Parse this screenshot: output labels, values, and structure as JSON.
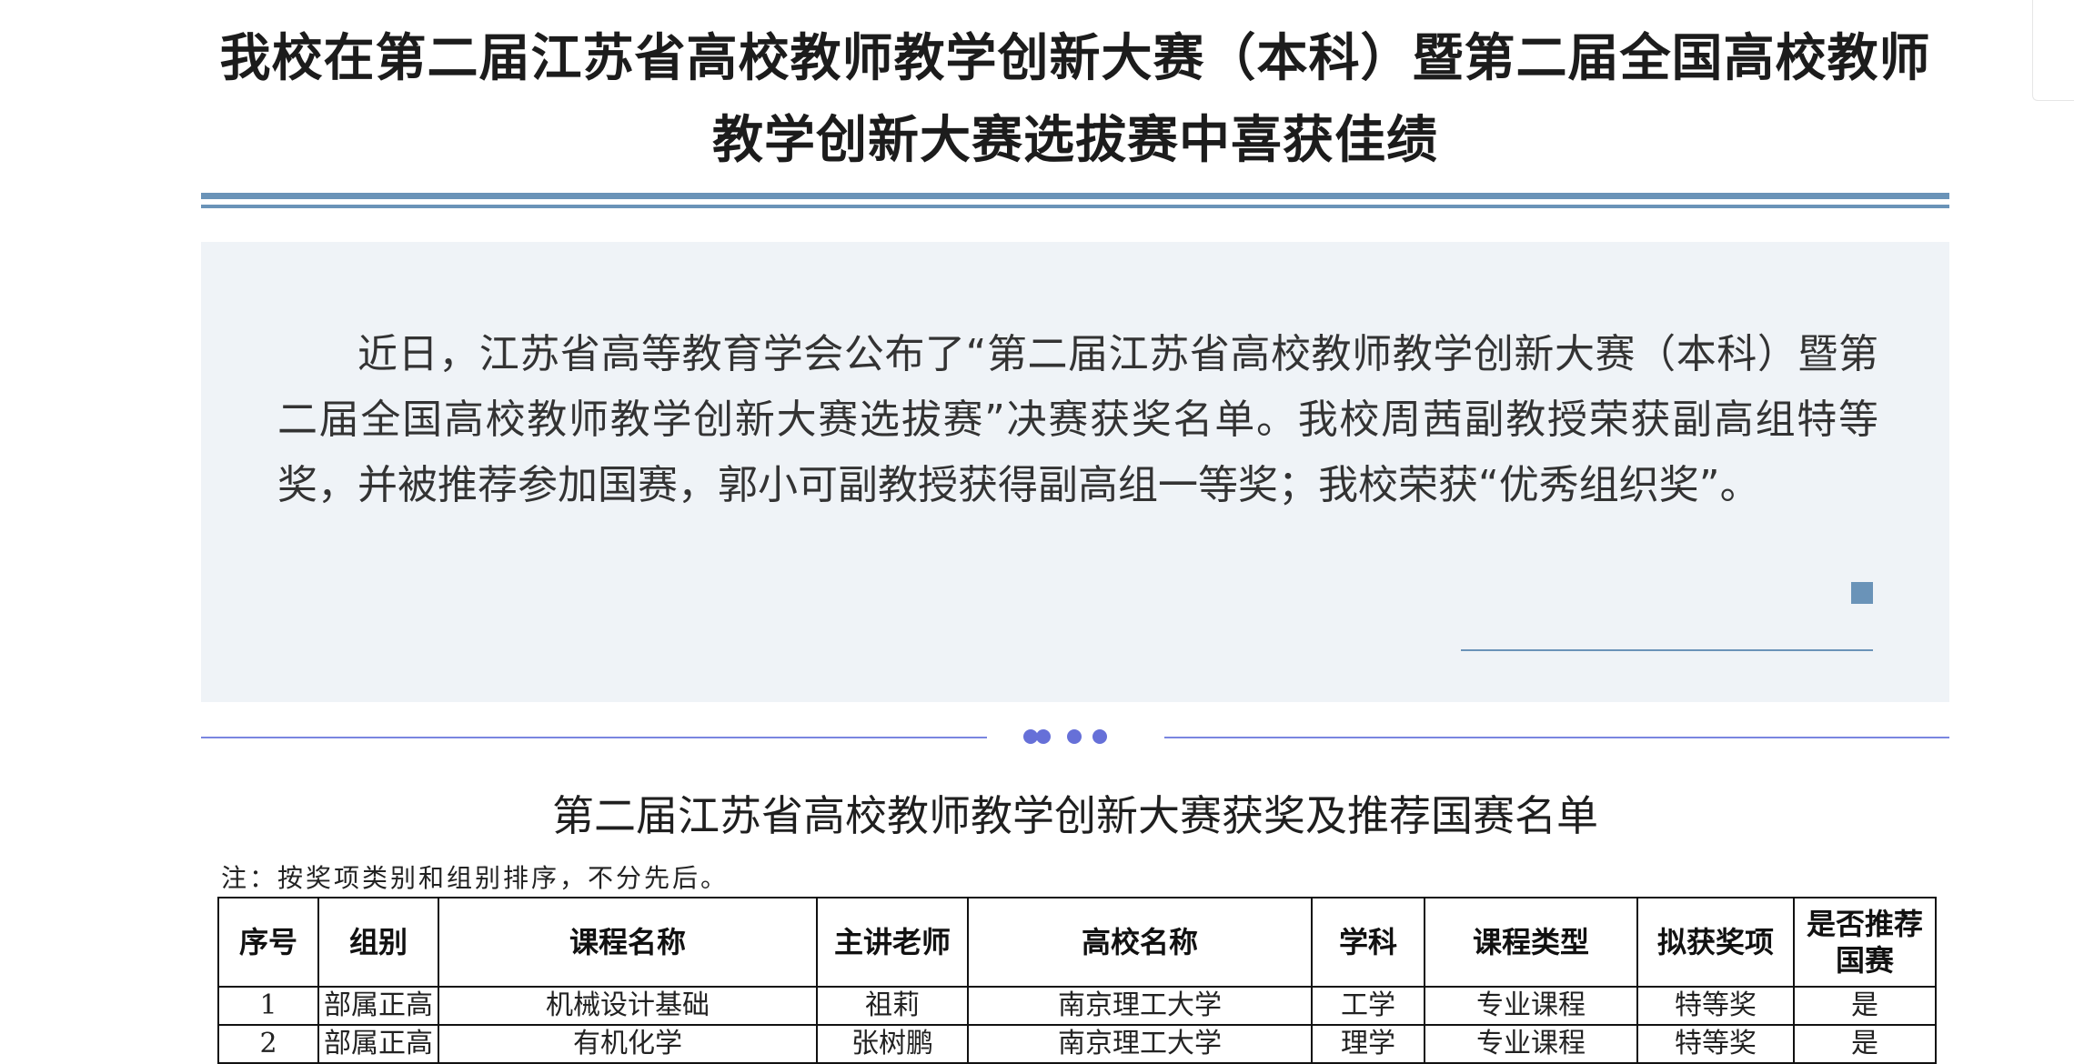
{
  "article": {
    "title": "我校在第二届江苏省高校教师教学创新大赛（本科）暨第二届全国高校教师教学创新大赛选拔赛中喜获佳绩",
    "summary": "近日，江苏省高等教育学会公布了“第二届江苏省高校教师教学创新大赛（本科）暨第二届全国高校教师教学创新大赛选拔赛”决赛获奖名单。我校周茜副教授荣获副高组特等奖，并被推荐参加国赛，郭小可副教授获得副高组一等奖；我校荣获“优秀组织奖”。"
  },
  "table_section": {
    "title": "第二届江苏省高校教师教学创新大赛获奖及推荐国赛名单",
    "note": "注：按奖项类别和组别排序，不分先后。",
    "headers": [
      "序号",
      "组别",
      "课程名称",
      "主讲老师",
      "高校名称",
      "学科",
      "课程类型",
      "拟获奖项",
      "是否推荐国赛"
    ],
    "rows": [
      [
        "1",
        "部属正高",
        "机械设计基础",
        "祖莉",
        "南京理工大学",
        "工学",
        "专业课程",
        "特等奖",
        "是"
      ],
      [
        "2",
        "部属正高",
        "有机化学",
        "张树鹏",
        "南京理工大学",
        "理学",
        "专业课程",
        "特等奖",
        "是"
      ]
    ]
  },
  "colors": {
    "accent": "#6a93b8",
    "summary_bg": "#eff3f7",
    "divider": "#7a86e0"
  }
}
